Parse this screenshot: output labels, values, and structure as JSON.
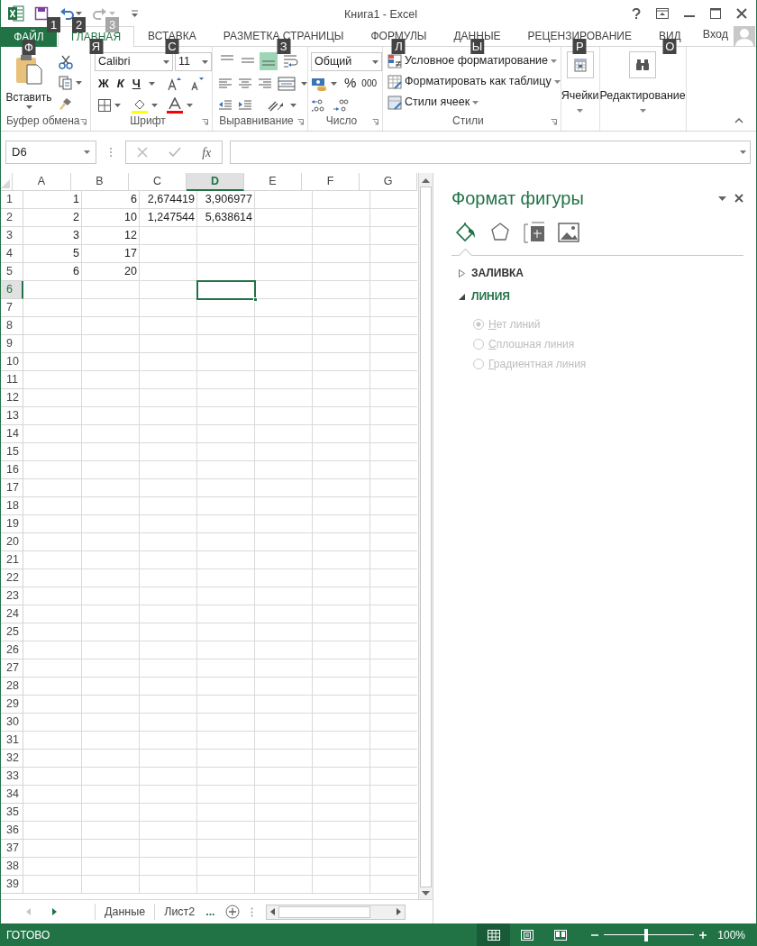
{
  "window": {
    "title": "Книга1 - Excel"
  },
  "quick_access": [
    {
      "kind": "save",
      "key_tip": "1",
      "disabled": false
    },
    {
      "kind": "undo",
      "key_tip": "2",
      "disabled": false
    },
    {
      "kind": "redo",
      "key_tip": "3",
      "disabled": true
    }
  ],
  "file_tab": {
    "label": "ФАЙЛ",
    "key_tip": "Ф"
  },
  "tabs": [
    {
      "label": "ГЛАВНАЯ",
      "key_tip": "Я",
      "selected": true
    },
    {
      "label": "ВСТАВКА",
      "key_tip": "С",
      "selected": false
    },
    {
      "label": "РАЗМЕТКА СТРАНИЦЫ",
      "key_tip": "З",
      "selected": false
    },
    {
      "label": "ФОРМУЛЫ",
      "key_tip": "Л",
      "selected": false
    },
    {
      "label": "ДАННЫЕ",
      "key_tip": "Ы",
      "selected": false
    },
    {
      "label": "РЕЦЕНЗИРОВАНИЕ",
      "key_tip": "Р",
      "selected": false
    },
    {
      "label": "ВИД",
      "key_tip": "О",
      "selected": false
    }
  ],
  "account": {
    "label": "Вход"
  },
  "ribbon": {
    "clipboard": {
      "label": "Буфер обмена",
      "paste": "Вставить"
    },
    "font": {
      "label": "Шрифт",
      "font_name": "Calibri",
      "font_size": "11",
      "bold": "Ж",
      "italic": "К",
      "underline": "Ч"
    },
    "alignment": {
      "label": "Выравнивание",
      "vertical": [
        {
          "kind": "top",
          "selected": false
        },
        {
          "kind": "middle",
          "selected": false
        },
        {
          "kind": "bottom",
          "selected": true
        }
      ]
    },
    "number": {
      "label": "Число",
      "format": "Общий",
      "percent": "%",
      "thousands": "000"
    },
    "styles": {
      "label": "Стили",
      "items": [
        {
          "kind": "conditional",
          "label": "Условное форматирование"
        },
        {
          "kind": "table",
          "label": "Форматировать как таблицу"
        },
        {
          "kind": "cell",
          "label": "Стили ячеек"
        }
      ]
    },
    "cells": {
      "label": "Ячейки"
    },
    "editing": {
      "label": "Редактирование"
    }
  },
  "formula_bar": {
    "name_box": "D6",
    "function_label": "fx"
  },
  "sheet": {
    "columns": [
      {
        "label": "A",
        "selected": false
      },
      {
        "label": "B",
        "selected": false
      },
      {
        "label": "C",
        "selected": false
      },
      {
        "label": "D",
        "selected": true
      },
      {
        "label": "E",
        "selected": false
      },
      {
        "label": "F",
        "selected": false
      },
      {
        "label": "G",
        "selected": false
      }
    ],
    "rows": [
      {
        "label": "1",
        "selected": false,
        "cells": [
          "1",
          "6",
          "2,674419",
          "3,906977"
        ]
      },
      {
        "label": "2",
        "selected": false,
        "cells": [
          "2",
          "10",
          "1,247544",
          "5,638614"
        ]
      },
      {
        "label": "3",
        "selected": false,
        "cells": [
          "3",
          "12"
        ]
      },
      {
        "label": "4",
        "selected": false,
        "cells": [
          "5",
          "17"
        ]
      },
      {
        "label": "5",
        "selected": false,
        "cells": [
          "6",
          "20"
        ]
      },
      {
        "label": "6",
        "selected": true
      },
      {
        "label": "7",
        "selected": false
      },
      {
        "label": "8",
        "selected": false
      },
      {
        "label": "9",
        "selected": false
      },
      {
        "label": "10",
        "selected": false
      },
      {
        "label": "11",
        "selected": false
      },
      {
        "label": "12",
        "selected": false
      },
      {
        "label": "13",
        "selected": false
      },
      {
        "label": "14",
        "selected": false
      },
      {
        "label": "15",
        "selected": false
      },
      {
        "label": "16",
        "selected": false
      },
      {
        "label": "17",
        "selected": false
      },
      {
        "label": "18",
        "selected": false
      },
      {
        "label": "19",
        "selected": false
      },
      {
        "label": "20",
        "selected": false
      },
      {
        "label": "21",
        "selected": false
      },
      {
        "label": "22",
        "selected": false
      },
      {
        "label": "23",
        "selected": false
      },
      {
        "label": "24",
        "selected": false
      },
      {
        "label": "25",
        "selected": false
      },
      {
        "label": "26",
        "selected": false
      },
      {
        "label": "27",
        "selected": false
      },
      {
        "label": "28",
        "selected": false
      },
      {
        "label": "29",
        "selected": false
      },
      {
        "label": "30",
        "selected": false
      },
      {
        "label": "31",
        "selected": false
      },
      {
        "label": "32",
        "selected": false
      },
      {
        "label": "33",
        "selected": false
      },
      {
        "label": "34",
        "selected": false
      },
      {
        "label": "35",
        "selected": false
      },
      {
        "label": "36",
        "selected": false
      },
      {
        "label": "37",
        "selected": false
      },
      {
        "label": "38",
        "selected": false
      },
      {
        "label": "39",
        "selected": false
      }
    ]
  },
  "format_pane": {
    "title": "Формат фигуры",
    "tabs": [
      {
        "kind": "fill",
        "selected": true
      },
      {
        "kind": "shape",
        "selected": false
      },
      {
        "kind": "size",
        "selected": false
      },
      {
        "kind": "picture",
        "selected": false
      }
    ],
    "sections": [
      {
        "label": "ЗАЛИВКА",
        "expanded": false
      },
      {
        "label": "ЛИНИЯ",
        "expanded": true,
        "options": [
          {
            "label": "Нет линий",
            "selected": true,
            "disabled": true
          },
          {
            "label": "Сплошная линия",
            "selected": false,
            "disabled": true
          },
          {
            "label": "Градиентная линия",
            "selected": false,
            "disabled": true
          }
        ]
      }
    ]
  },
  "sheet_tabs": {
    "tabs": [
      {
        "label": "Данные",
        "selected": false
      },
      {
        "label": "Лист2",
        "selected": false
      }
    ],
    "more": "..."
  },
  "status_bar": {
    "status": "ГОТОВО",
    "views": [
      {
        "kind": "normal",
        "selected": true
      },
      {
        "kind": "page_layout",
        "selected": false
      },
      {
        "kind": "page_break",
        "selected": false
      }
    ],
    "zoom": {
      "level": 0.47,
      "label": "100%"
    }
  }
}
